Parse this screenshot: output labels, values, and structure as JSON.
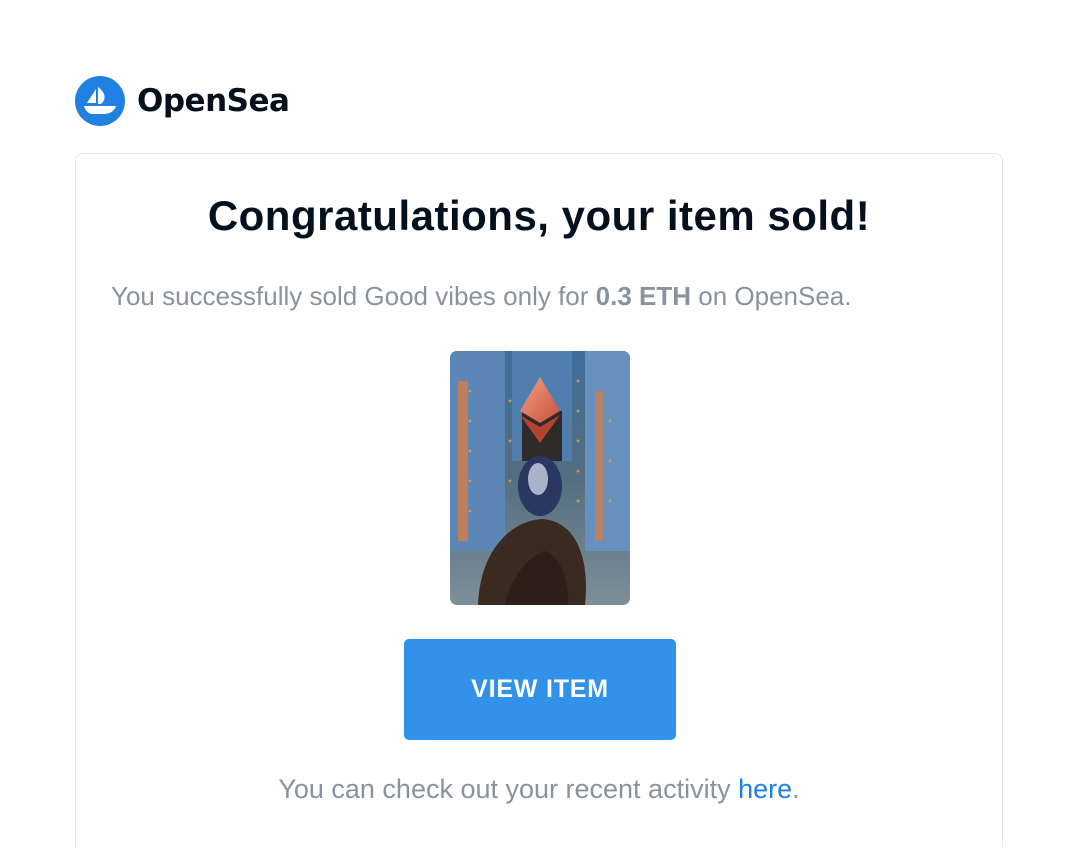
{
  "brand": {
    "name": "OpenSea",
    "logo_icon": "sailboat-icon",
    "logo_color": "#2081e2"
  },
  "email": {
    "headline": "Congratulations, your item sold!",
    "message_prefix": "You successfully sold Good vibes only for ",
    "price": "0.3 ETH",
    "message_suffix": " on OpenSea.",
    "item_image_icon": "nft-artwork-image",
    "button_label": "VIEW ITEM",
    "button_color": "#3291e9",
    "footer_prefix": "You can check out your recent activity ",
    "footer_link": "here",
    "footer_suffix": "."
  }
}
